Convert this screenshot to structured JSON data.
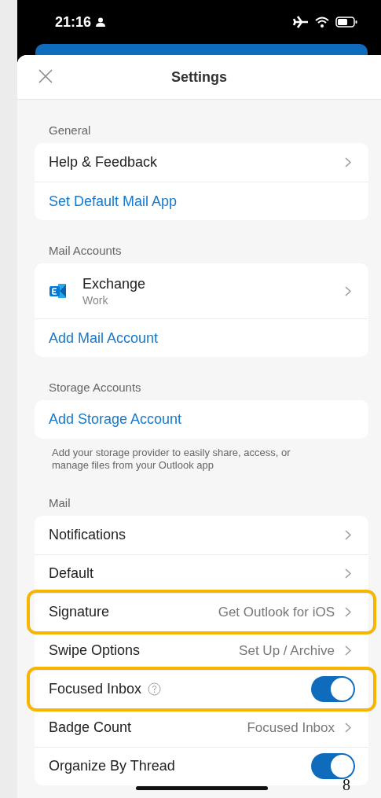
{
  "status_bar": {
    "time": "21:16"
  },
  "header": {
    "title": "Settings"
  },
  "sections": [
    {
      "title": "General",
      "rows": [
        {
          "kind": "nav",
          "label": "Help & Feedback",
          "highlighted": false
        },
        {
          "kind": "link",
          "label": "Set Default Mail App",
          "highlighted": false
        }
      ]
    },
    {
      "title": "Mail Accounts",
      "rows": [
        {
          "kind": "account",
          "label": "Exchange",
          "sublabel": "Work",
          "highlighted": false
        },
        {
          "kind": "link",
          "label": "Add Mail Account",
          "highlighted": false
        }
      ]
    },
    {
      "title": "Storage Accounts",
      "rows": [
        {
          "kind": "link",
          "label": "Add Storage Account",
          "highlighted": false
        }
      ],
      "footer": "Add your storage provider to easily share, access, or manage files from your Outlook app"
    },
    {
      "title": "Mail",
      "rows": [
        {
          "kind": "nav",
          "label": "Notifications",
          "highlighted": false
        },
        {
          "kind": "nav",
          "label": "Default",
          "highlighted": false
        },
        {
          "kind": "nav",
          "label": "Signature",
          "value": "Get Outlook for iOS",
          "highlighted": true
        },
        {
          "kind": "nav",
          "label": "Swipe Options",
          "value": "Set Up / Archive",
          "highlighted": false
        },
        {
          "kind": "toggle",
          "label": "Focused Inbox",
          "help": true,
          "on": true,
          "highlighted": true
        },
        {
          "kind": "nav",
          "label": "Badge Count",
          "value": "Focused Inbox",
          "highlighted": false
        },
        {
          "kind": "toggle",
          "label": "Organize By Thread",
          "help": false,
          "on": true,
          "highlighted": false
        }
      ]
    }
  ],
  "page_number": "8"
}
